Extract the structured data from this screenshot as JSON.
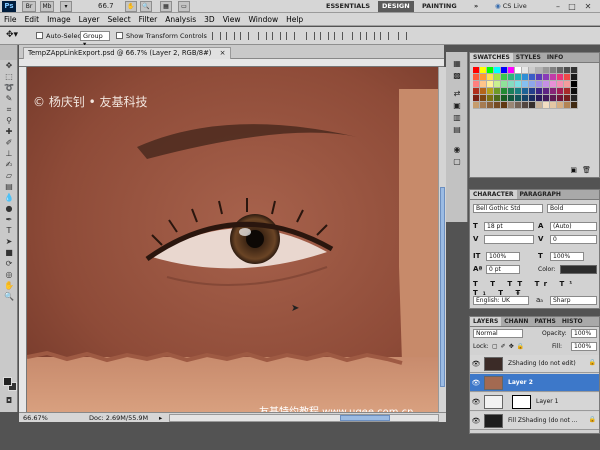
{
  "app": {
    "logo": "Ps",
    "zoom": "66.7",
    "workspaces": [
      "ESSENTIALS",
      "DESIGN",
      "PAINTING"
    ],
    "active_workspace": "DESIGN",
    "more": "»",
    "cs_live": "CS Live",
    "win_controls": [
      "–",
      "□",
      "✕"
    ]
  },
  "menu": [
    "File",
    "Edit",
    "Image",
    "Layer",
    "Select",
    "Filter",
    "Analysis",
    "3D",
    "View",
    "Window",
    "Help"
  ],
  "options": {
    "auto_select_label": "Auto-Select:",
    "auto_select_value": "Group",
    "show_transform": "Show Transform Controls"
  },
  "document": {
    "tab_title": "TempZAppLinkExport.psd @ 66.7% (Layer 2, RGB/8#)",
    "close": "×",
    "watermark_top": "© 杨庆钊 • 友基科技",
    "watermark_bottom": "友基特约教程  www.ugee.com.cn",
    "zoom_status": "66.67%",
    "doc_status": "Doc: 2.69M/55.9M"
  },
  "swatches": {
    "tabs": [
      "SWATCHES",
      "STYLES",
      "INFO"
    ],
    "colors": [
      "#ff0000",
      "#ffff00",
      "#00ff00",
      "#00ffff",
      "#0000ff",
      "#ff00ff",
      "#ffffff",
      "#e6e6e6",
      "#cccccc",
      "#b3b3b3",
      "#999999",
      "#808080",
      "#666666",
      "#4d4d4d",
      "#333333",
      "#ff5a3c",
      "#ff9933",
      "#ffe24d",
      "#a4e346",
      "#3cc84b",
      "#2db67e",
      "#21b3b3",
      "#2f8fd6",
      "#3c5ec7",
      "#5b3cb8",
      "#8a3cb8",
      "#c23ca8",
      "#e8357a",
      "#f04848",
      "#1a1a1a",
      "#ff7f7f",
      "#ffc58a",
      "#fff09b",
      "#c9f08f",
      "#8fe39a",
      "#86dcc0",
      "#7edfe3",
      "#86bff0",
      "#8fa6ea",
      "#a48fe6",
      "#c68fe6",
      "#e88fd6",
      "#f58fb4",
      "#f39d9d",
      "#000000",
      "#b02d1c",
      "#b4651c",
      "#b3a21c",
      "#6d9a26",
      "#228b34",
      "#1b7f59",
      "#197e80",
      "#1d6296",
      "#243f8b",
      "#3c2484",
      "#5e2484",
      "#872477",
      "#a11d55",
      "#a82a2a",
      "#0d0d0d",
      "#7a1f14",
      "#7d4614",
      "#7c7013",
      "#4b6a1a",
      "#175f24",
      "#12573d",
      "#115758",
      "#144468",
      "#192b60",
      "#2a195c",
      "#41195c",
      "#5e1953",
      "#70143b",
      "#741d1d",
      "#262626",
      "#c69c6d",
      "#a67c52",
      "#8c6239",
      "#754c24",
      "#603913",
      "#998675",
      "#736357",
      "#534741",
      "#362f2d",
      "#c7b299",
      "#f1ddc2",
      "#e3c7a4",
      "#d6ae82",
      "#b38454",
      "#402a12"
    ]
  },
  "character": {
    "tabs": [
      "CHARACTER",
      "PARAGRAPH"
    ],
    "font": "Bell Gothic Std",
    "style": "Bold",
    "size": "18 pt",
    "leading": "(Auto)",
    "tracking": "0",
    "vscale": "100%",
    "hscale": "100%",
    "baseline": "0 pt",
    "color_label": "Color:",
    "language": "English: UK",
    "aa_label": "aₐ",
    "antialias": "Sharp"
  },
  "layers": {
    "tabs": [
      "LAYERS",
      "CHANN",
      "PATHS",
      "HISTO"
    ],
    "blend": "Normal",
    "opacity_label": "Opacity:",
    "opacity": "100%",
    "lock_label": "Lock:",
    "fill_label": "Fill:",
    "fill": "100%",
    "items": [
      {
        "name": "ZShading (do not edit)",
        "selected": false
      },
      {
        "name": "Layer 2",
        "selected": true
      },
      {
        "name": "Layer 1",
        "selected": false
      },
      {
        "name": "Fill ZShading (do not ...",
        "selected": false
      }
    ]
  }
}
